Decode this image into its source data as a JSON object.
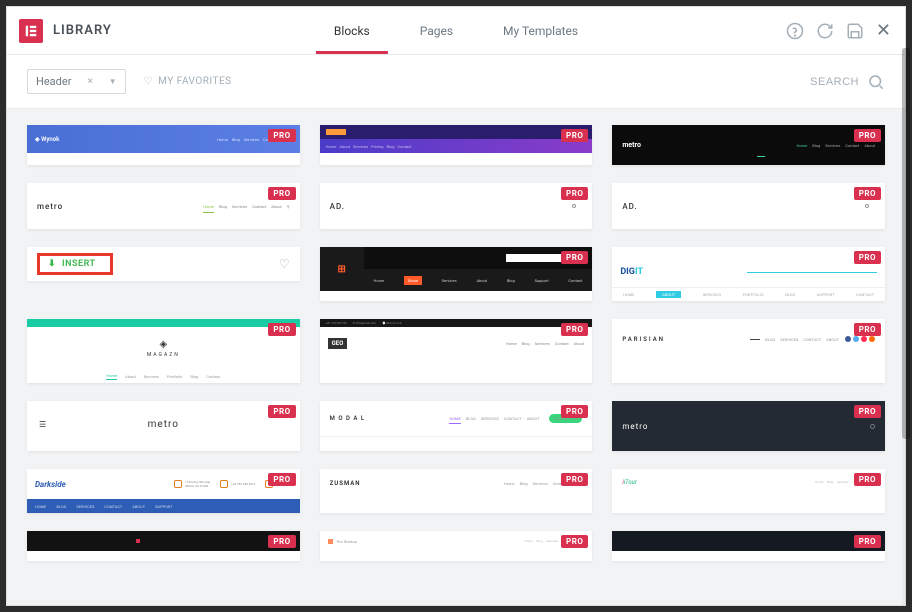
{
  "header": {
    "title": "LIBRARY",
    "tabs": [
      "Blocks",
      "Pages",
      "My Templates"
    ],
    "active_tab": 0
  },
  "toolbar": {
    "filter_value": "Header",
    "favorites_label": "MY FAVORITES",
    "search_placeholder": "SEARCH"
  },
  "badge": {
    "pro": "PRO"
  },
  "insert": {
    "label": "INSERT"
  },
  "thumbs": {
    "wynok": "Wynok",
    "metro": "metro",
    "ad": "AD.",
    "armono_menu": [
      "Home",
      "Show",
      "Services",
      "About",
      "Blog",
      "Support",
      "Contact"
    ],
    "dig": "DIG",
    "it": "IT",
    "dig_menu": [
      "HOME",
      "ABOUT",
      "SERVICES",
      "PORTFOLIO",
      "BLOG",
      "SUPPORT",
      "CONTACT"
    ],
    "magazn": "MAGAZN",
    "geo": "GEO",
    "parisian": "PARISIAN",
    "modal": "M O D A L",
    "modal_menu": [
      "HOME",
      "BLOG",
      "SERVICES",
      "CONTACT",
      "ABOUT"
    ],
    "darkside": "Darkside",
    "zusman": "ZUSMAN",
    "zusman_menu": [
      "Home",
      "Blog",
      "Services",
      "Contact",
      "About"
    ],
    "itour": "iTour",
    "generic_menu": [
      "Home",
      "Blog",
      "Services",
      "Contact",
      "About"
    ]
  }
}
